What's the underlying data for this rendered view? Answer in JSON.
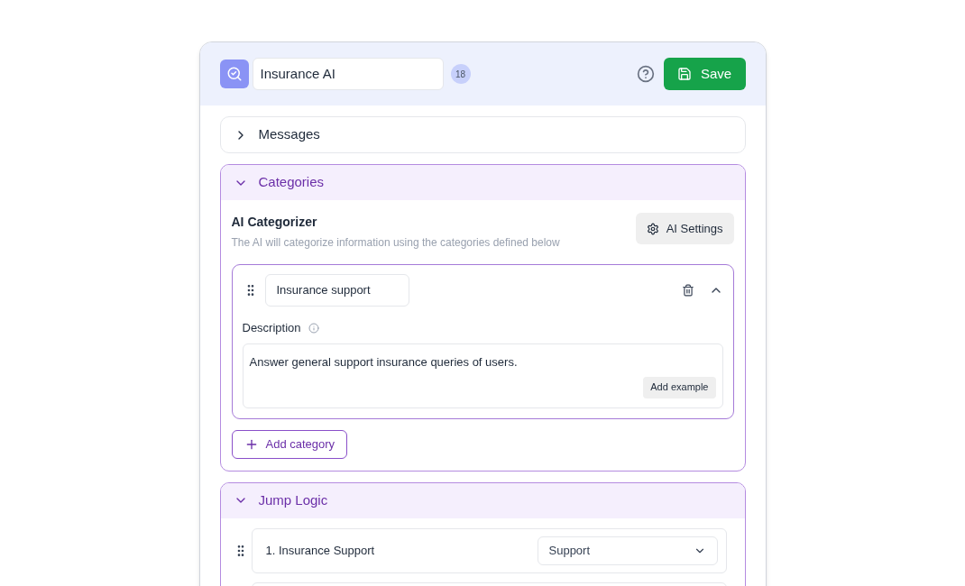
{
  "header": {
    "title_value": "Insurance AI",
    "count": "18",
    "save_label": "Save"
  },
  "sections": [
    {
      "title": "Messages",
      "expanded": false
    },
    {
      "kind": "categories",
      "title": "Categories",
      "expanded": true,
      "heading": "AI Categorizer",
      "subtitle": "The AI will categorize information using the categories defined below",
      "settings_label": "AI Settings",
      "categories": [
        {
          "name": "Insurance support",
          "expanded": true,
          "description_label": "Description",
          "description": "Answer general support insurance queries of users.",
          "example_label": "Add example"
        }
      ],
      "add_label": "Add category"
    },
    {
      "kind": "jump",
      "title": "Jump Logic",
      "expanded": true,
      "rows": [
        {
          "kind": "rule",
          "label": "1. Insurance Support",
          "target": "Support"
        },
        {
          "kind": "blank"
        }
      ]
    }
  ]
}
